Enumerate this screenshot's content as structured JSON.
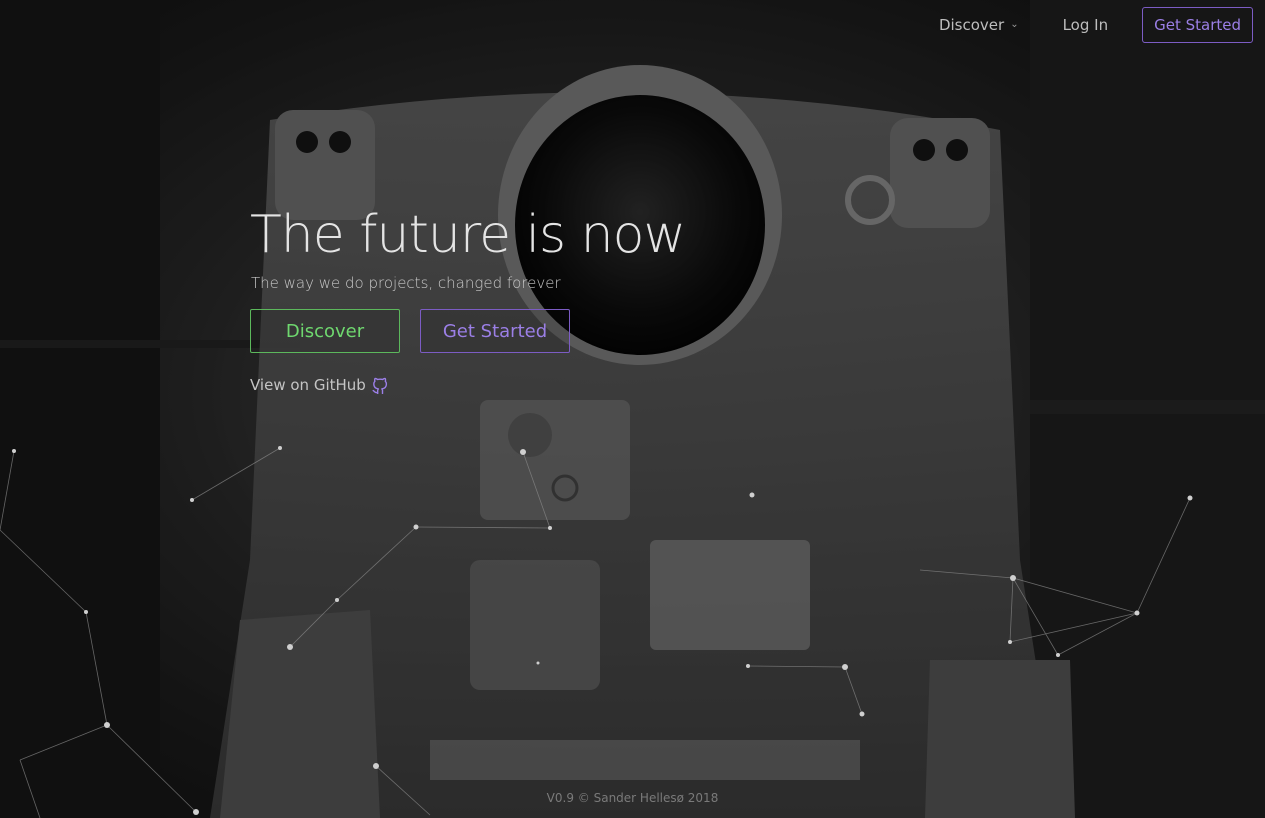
{
  "nav": {
    "discover_label": "Discover",
    "discover_icon": "chevron-down-icon",
    "login_label": "Log In",
    "get_started_label": "Get Started"
  },
  "hero": {
    "title": "The future is now",
    "subtitle": "The way we do projects, changed forever",
    "discover_button": "Discover",
    "get_started_button": "Get Started",
    "github_link": "View on GitHub",
    "github_icon": "github-icon"
  },
  "footer": {
    "text": "V0.9 © Sander Hellesø 2018"
  },
  "colors": {
    "accent_purple": "#7c5cc4",
    "accent_green": "#5cb85c",
    "text_light": "#e4e4e4"
  }
}
